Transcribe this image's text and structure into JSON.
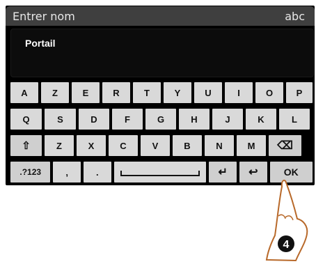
{
  "header": {
    "title": "Entrer nom",
    "mode": "abc"
  },
  "input": {
    "value": "Portail"
  },
  "keyboard": {
    "row1": [
      "A",
      "Z",
      "E",
      "R",
      "T",
      "Y",
      "U",
      "I",
      "O",
      "P"
    ],
    "row2": [
      "Q",
      "S",
      "D",
      "F",
      "G",
      "H",
      "J",
      "K",
      "L"
    ],
    "row3": {
      "shift": "⇧",
      "letters": [
        "Z",
        "X",
        "C",
        "V",
        "B",
        "N",
        "M"
      ],
      "backspace": "⌫"
    },
    "row4": {
      "numbers": ".?123",
      "comma": ",",
      "period": ".",
      "enter": "↵",
      "back": "↩",
      "ok": "OK"
    }
  },
  "callout": {
    "step": "4"
  }
}
